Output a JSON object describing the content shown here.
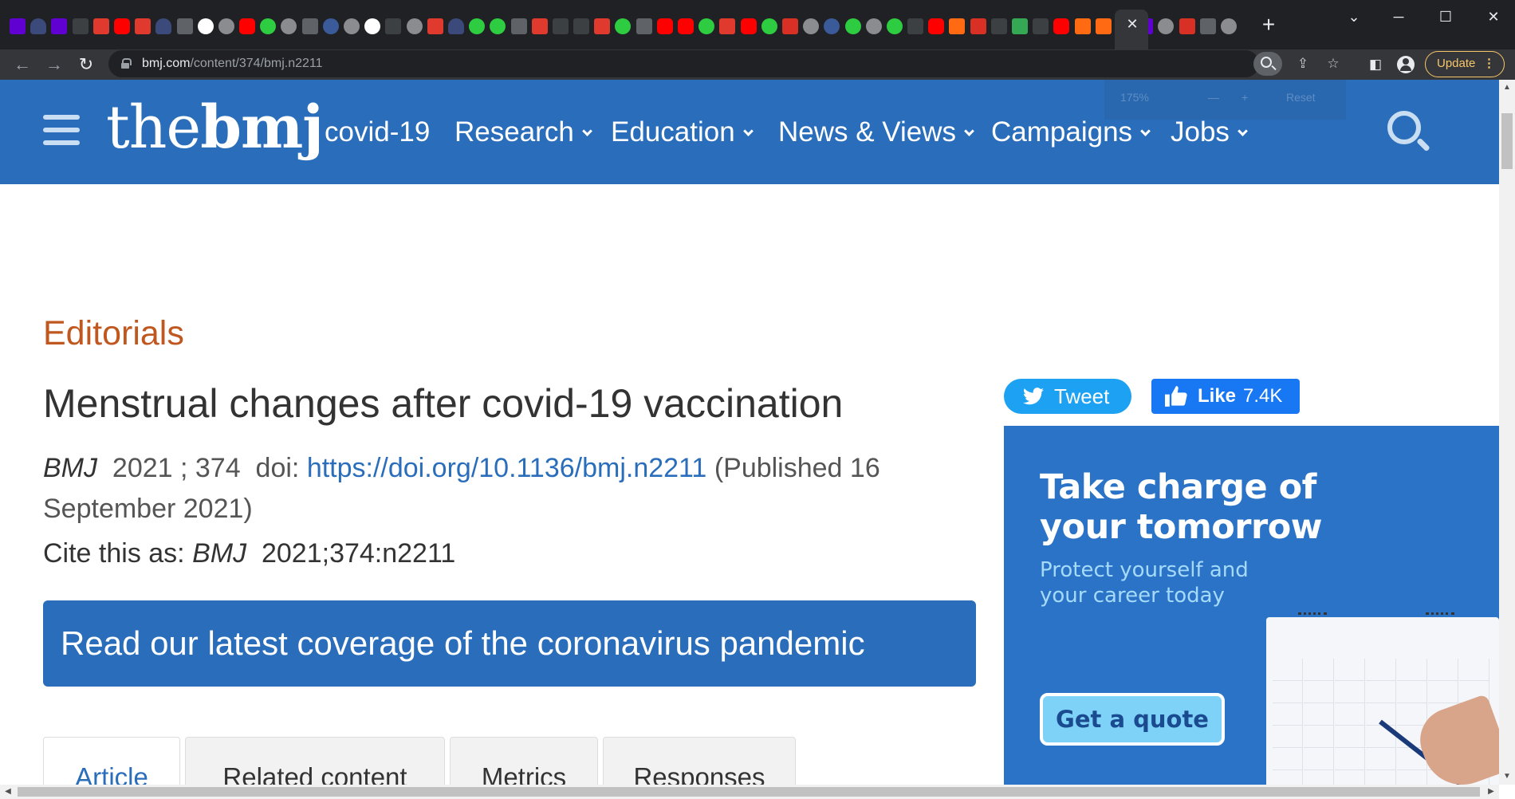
{
  "browser": {
    "url_host": "bmj.com",
    "url_path": "/content/374/bmj.n2211",
    "update_label": "Update",
    "new_tab_label": "+",
    "close_tab_label": "✕",
    "tab_favicons": [
      "yahoo",
      "shield",
      "yahoo",
      "ft",
      "bi",
      "youtube",
      "bi",
      "shield",
      "flag",
      "grid",
      "globe",
      "youtube",
      "play",
      "globe",
      "flag",
      "search",
      "globe",
      "google",
      "ft",
      "globe",
      "bi",
      "shield",
      "play",
      "play",
      "flag",
      "bi",
      "ft",
      "dark",
      "bi",
      "play",
      "flag",
      "youtube",
      "youtube",
      "play",
      "bi",
      "youtube",
      "play",
      "red",
      "globe",
      "search",
      "play",
      "globe",
      "play",
      "dark",
      "youtube",
      "orange",
      "red",
      "dark",
      "green",
      "dark",
      "youtube",
      "orange",
      "orange",
      "dark",
      "yahoo",
      "globe",
      "red",
      "flag",
      "globe"
    ]
  },
  "site": {
    "logo_the": "the",
    "logo_bmj": "bmj",
    "nav": [
      {
        "label": "covid-19",
        "dropdown": false
      },
      {
        "label": "Research",
        "dropdown": true
      },
      {
        "label": "Education",
        "dropdown": true
      },
      {
        "label": "News & Views",
        "dropdown": true
      },
      {
        "label": "Campaigns",
        "dropdown": true
      },
      {
        "label": "Jobs",
        "dropdown": true
      }
    ],
    "brand_color": "#2a6ebb"
  },
  "article": {
    "section": "Editorials",
    "title": "Menstrual changes after covid-19 vaccination",
    "journal": "BMJ",
    "year": "2021",
    "volume": "374",
    "doi_label": "doi:",
    "doi_url": "https://doi.org/10.1136/bmj.n2211",
    "published": "(Published 16 September 2021)",
    "cite_prefix": "Cite this as:",
    "cite_journal": "BMJ",
    "cite_ref": "2021;374:n2211",
    "covid_banner": "Read our latest coverage of the coronavirus pandemic"
  },
  "tabs": [
    {
      "label": "Article",
      "active": true
    },
    {
      "label": "Related content",
      "active": false
    },
    {
      "label": "Metrics",
      "active": false
    },
    {
      "label": "Responses",
      "active": false
    }
  ],
  "social": {
    "tweet_label": "Tweet",
    "like_label": "Like",
    "like_count": "7.4K"
  },
  "ad": {
    "headline_line1": "Take charge of",
    "headline_line2": "your tomorrow",
    "subtext": "Protect yourself and your career today",
    "cta": "Get a quote"
  }
}
